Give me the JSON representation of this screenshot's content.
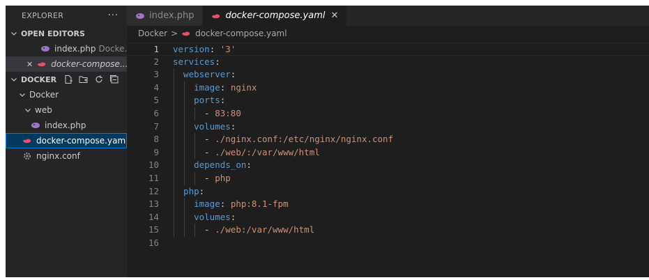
{
  "sidebar": {
    "header": "EXPLORER",
    "more": "···",
    "open_editors": {
      "title": "OPEN EDITORS",
      "items": [
        {
          "name": "index.php",
          "desc": "Docke..."
        },
        {
          "close": "✕",
          "name": "docker-compose...."
        }
      ]
    },
    "workspace": {
      "title": "DOCKER",
      "tree": [
        {
          "label": "Docker"
        },
        {
          "label": "web"
        },
        {
          "label": "index.php"
        },
        {
          "label": "docker-compose.yaml"
        },
        {
          "label": "nginx.conf"
        }
      ]
    }
  },
  "tabs": [
    {
      "label": "index.php",
      "icon": "php-icon"
    },
    {
      "label": "docker-compose.yaml",
      "icon": "whale-icon",
      "close": "✕"
    }
  ],
  "breadcrumb": {
    "folder": "Docker",
    "file": "docker-compose.yaml"
  },
  "editor": {
    "line_numbers": [
      "1",
      "2",
      "3",
      "4",
      "5",
      "6",
      "7",
      "8",
      "9",
      "10",
      "11",
      "12",
      "13",
      "14",
      "15",
      "16"
    ],
    "lines": [
      {
        "indent": 0,
        "key": "version",
        "value": "'3'"
      },
      {
        "indent": 0,
        "key": "services",
        "value": ""
      },
      {
        "indent": 1,
        "key": "webserver",
        "value": ""
      },
      {
        "indent": 2,
        "key": "image",
        "value": "nginx"
      },
      {
        "indent": 2,
        "key": "ports",
        "value": ""
      },
      {
        "indent": 3,
        "dash": "-",
        "value": "83:80"
      },
      {
        "indent": 2,
        "key": "volumes",
        "value": ""
      },
      {
        "indent": 3,
        "dash": "-",
        "value": "./nginx.conf:/etc/nginx/nginx.conf"
      },
      {
        "indent": 3,
        "dash": "-",
        "value": "./web/:/var/www/html"
      },
      {
        "indent": 2,
        "key": "depends_on",
        "value": ""
      },
      {
        "indent": 3,
        "dash": "-",
        "value": "php"
      },
      {
        "indent": 1,
        "key": "php",
        "value": ""
      },
      {
        "indent": 2,
        "key": "image",
        "value": "php:8.1-fpm"
      },
      {
        "indent": 2,
        "key": "volumes",
        "value": ""
      },
      {
        "indent": 3,
        "dash": "-",
        "value": "./web:/var/www/html"
      },
      {
        "indent": 0,
        "key": "",
        "value": ""
      }
    ]
  },
  "colors": {
    "key": "#569cd6",
    "string": "#ce9178",
    "php_icon": "#a074c4",
    "yaml_icon": "#e8506a"
  }
}
